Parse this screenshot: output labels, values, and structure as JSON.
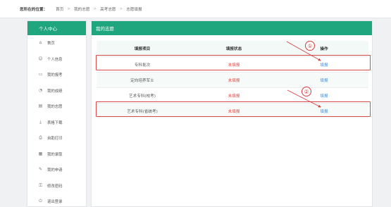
{
  "breadcrumb": {
    "label": "您所在的位置：",
    "items": [
      "首页",
      "我的志愿",
      "高考志愿",
      "志愿填报"
    ],
    "separator": ">"
  },
  "sidebar": {
    "title": "个人中心",
    "items": [
      {
        "label": "首页",
        "icon": "home-icon"
      },
      {
        "label": "个人信息",
        "icon": "user-icon"
      },
      {
        "label": "我的报考",
        "icon": "id-card-icon"
      },
      {
        "label": "我的成绩",
        "icon": "chart-icon"
      },
      {
        "label": "我的志愿",
        "icon": "document-icon"
      },
      {
        "label": "表格下载",
        "icon": "download-icon"
      },
      {
        "label": "自助打印",
        "icon": "printer-icon"
      },
      {
        "label": "我的录取",
        "icon": "calendar-icon"
      },
      {
        "label": "我的申请",
        "icon": "edit-icon"
      },
      {
        "label": "修改密码",
        "icon": "lock-icon"
      },
      {
        "label": "退出登录",
        "icon": "logout-icon"
      }
    ]
  },
  "main": {
    "title": "我的志愿",
    "table": {
      "headers": [
        "填报项目",
        "填报状态",
        "操作"
      ],
      "rows": [
        {
          "project": "专科批次",
          "status": "未填报",
          "action": "填报"
        },
        {
          "project": "定向培养军士",
          "status": "未填报",
          "action": "填报"
        },
        {
          "project": "艺术专科(校考)",
          "status": "未填报",
          "action": "填报"
        },
        {
          "project": "艺术专科(省统考)",
          "status": "未填报",
          "action": "填报"
        }
      ]
    }
  },
  "annotations": {
    "marker_1": "①",
    "marker_2": "②",
    "highlight_color": "#d94a4a"
  },
  "colors": {
    "accent": "#1fa67e",
    "status_red": "#e0463f",
    "link_blue": "#3a8ee6"
  }
}
